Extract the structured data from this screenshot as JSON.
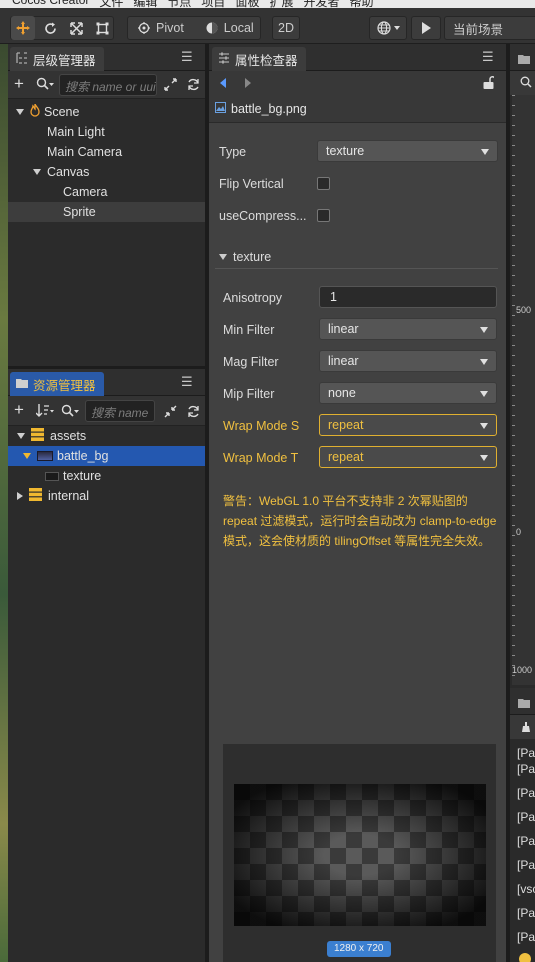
{
  "menubar": {
    "items": [
      "Cocos Creator",
      "文件",
      "编辑",
      "节点",
      "项目",
      "面板",
      "扩展",
      "开发者",
      "帮助"
    ]
  },
  "toolbar": {
    "pivot_label": "Pivot",
    "local_label": "Local",
    "mode_2d_label": "2D",
    "scene_label": "当前场景"
  },
  "hierarchy": {
    "title": "层级管理器",
    "search_placeholder": "搜索 name or uuid",
    "nodes": [
      {
        "label": "Scene"
      },
      {
        "label": "Main Light"
      },
      {
        "label": "Main Camera"
      },
      {
        "label": "Canvas"
      },
      {
        "label": "Camera"
      },
      {
        "label": "Sprite"
      }
    ]
  },
  "assets": {
    "title": "资源管理器",
    "search_placeholder": "搜索 name",
    "items": [
      {
        "label": "assets"
      },
      {
        "label": "battle_bg"
      },
      {
        "label": "texture"
      },
      {
        "label": "internal"
      }
    ]
  },
  "inspector": {
    "title": "属性检查器",
    "asset_name": "battle_bg.png",
    "type_label": "Type",
    "type_value": "texture",
    "flip_label": "Flip Vertical",
    "compress_label": "useCompress...",
    "section_label": "texture",
    "anisotropy_label": "Anisotropy",
    "anisotropy_value": "1",
    "min_filter_label": "Min Filter",
    "min_filter_value": "linear",
    "mag_filter_label": "Mag Filter",
    "mag_filter_value": "linear",
    "mip_filter_label": "Mip Filter",
    "mip_filter_value": "none",
    "wrap_s_label": "Wrap Mode S",
    "wrap_s_value": "repeat",
    "wrap_t_label": "Wrap Mode T",
    "wrap_t_value": "repeat",
    "warning_line1": "警告：WebGL 1.0 平台不支持非 2 次幂贴图的",
    "warning_line2": "repeat 过滤模式，运行时会自动改为 clamp-to-edge",
    "warning_line3": "模式，这会使材质的 tilingOffset 等属性完全失效。",
    "preview_size": "1280 x 720"
  },
  "scene": {
    "ruler_500": "500",
    "ruler_0": "0",
    "ruler_1000": "1000"
  },
  "console": {
    "lines": [
      "[Pa",
      "[Pa",
      "[Pa",
      "[Pa",
      "[Pa",
      "[Pa",
      "[vsc",
      "[Pa",
      "[Pa"
    ]
  },
  "colors": {
    "accent_blue": "#2458b0",
    "warning_yellow": "#f0c040"
  }
}
